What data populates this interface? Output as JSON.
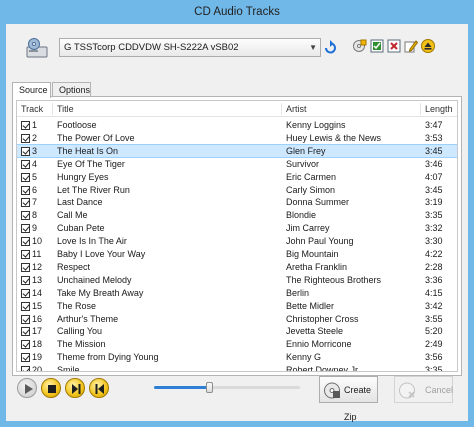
{
  "window": {
    "title": "CD Audio Tracks"
  },
  "toolbar": {
    "drive": "G TSSTcorp CDDVDW SH-S222A vSB02",
    "icons": [
      "cd-drive-icon",
      "refresh-icon",
      "cdtext-icon",
      "select-all-icon",
      "deselect-all-icon",
      "edit-icon",
      "eject-icon"
    ]
  },
  "tabs": [
    {
      "label": "Source",
      "active": true
    },
    {
      "label": "Options",
      "active": false
    }
  ],
  "columns": {
    "track": "Track",
    "title": "Title",
    "artist": "Artist",
    "length": "Length"
  },
  "tracks": [
    {
      "num": "1",
      "title": "Footloose",
      "artist": "Kenny Loggins",
      "length": "3:47",
      "checked": true,
      "selected": false
    },
    {
      "num": "2",
      "title": "The Power Of Love",
      "artist": "Huey Lewis & the News",
      "length": "3:53",
      "checked": true,
      "selected": false
    },
    {
      "num": "3",
      "title": "The Heat Is On",
      "artist": "Glen Frey",
      "length": "3:45",
      "checked": true,
      "selected": true
    },
    {
      "num": "4",
      "title": "Eye Of The Tiger",
      "artist": "Survivor",
      "length": "3:46",
      "checked": true,
      "selected": false
    },
    {
      "num": "5",
      "title": "Hungry Eyes",
      "artist": "Eric Carmen",
      "length": "4:07",
      "checked": true,
      "selected": false
    },
    {
      "num": "6",
      "title": "Let The River Run",
      "artist": "Carly Simon",
      "length": "3:45",
      "checked": true,
      "selected": false
    },
    {
      "num": "7",
      "title": "Last Dance",
      "artist": "Donna Summer",
      "length": "3:19",
      "checked": true,
      "selected": false
    },
    {
      "num": "8",
      "title": "Call Me",
      "artist": "Blondie",
      "length": "3:35",
      "checked": true,
      "selected": false
    },
    {
      "num": "9",
      "title": "Cuban Pete",
      "artist": "Jim Carrey",
      "length": "3:32",
      "checked": true,
      "selected": false
    },
    {
      "num": "10",
      "title": "Love Is In The Air",
      "artist": "John Paul Young",
      "length": "3:30",
      "checked": true,
      "selected": false
    },
    {
      "num": "11",
      "title": "Baby I Love Your Way",
      "artist": "Big Mountain",
      "length": "4:22",
      "checked": true,
      "selected": false
    },
    {
      "num": "12",
      "title": "Respect",
      "artist": "Aretha Franklin",
      "length": "2:28",
      "checked": true,
      "selected": false
    },
    {
      "num": "13",
      "title": "Unchained Melody",
      "artist": "The Righteous Brothers",
      "length": "3:36",
      "checked": true,
      "selected": false
    },
    {
      "num": "14",
      "title": "Take My Breath Away",
      "artist": "Berlin",
      "length": "4:15",
      "checked": true,
      "selected": false
    },
    {
      "num": "15",
      "title": "The Rose",
      "artist": "Bette Midler",
      "length": "3:42",
      "checked": true,
      "selected": false
    },
    {
      "num": "16",
      "title": "Arthur's Theme",
      "artist": "Christopher Cross",
      "length": "3:55",
      "checked": true,
      "selected": false
    },
    {
      "num": "17",
      "title": "Calling You",
      "artist": "Jevetta Steele",
      "length": "5:20",
      "checked": true,
      "selected": false
    },
    {
      "num": "18",
      "title": "The Mission",
      "artist": "Ennio Morricone",
      "length": "2:49",
      "checked": true,
      "selected": false
    },
    {
      "num": "19",
      "title": "Theme from Dying Young",
      "artist": "Kenny G",
      "length": "3:56",
      "checked": true,
      "selected": false
    },
    {
      "num": "20",
      "title": "Smile",
      "artist": "Robert Downey Jr.",
      "length": "3:35",
      "checked": true,
      "selected": false
    }
  ],
  "player": {
    "buttons": [
      "play-icon",
      "stop-icon",
      "next-icon",
      "previous-icon"
    ],
    "progress": 0.38
  },
  "actions": {
    "create": "Create Zip",
    "cancel": "Cancel"
  },
  "colors": {
    "titlebar": "#70b8e8",
    "selection": "#cde8ff",
    "accent": "#2f7fd6",
    "gold": "#f2c21a"
  }
}
